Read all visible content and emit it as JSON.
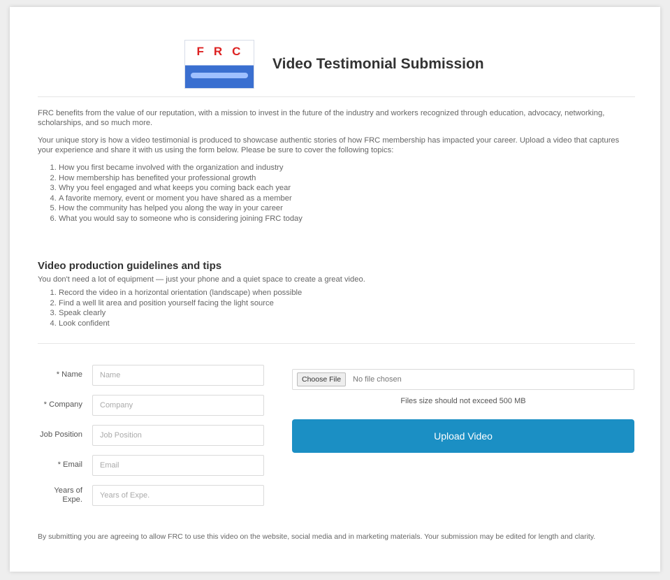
{
  "header": {
    "logo_text": "FRC",
    "title": "Video Testimonial Submission"
  },
  "intro": {
    "paragraph1": "FRC benefits from the value of our reputation, with a mission to invest in the future of the industry and workers recognized through education, advocacy, networking, scholarships, and so much more.",
    "paragraph2": "Your unique story is how a video testimonial is produced to showcase authentic stories of how FRC membership has impacted your career. Upload a video that captures your experience and share it with us using the form below. Please be sure to cover the following topics:",
    "list": [
      "How you first became involved with the organization and industry",
      "How membership has benefited your professional growth",
      "Why you feel engaged and what keeps you coming back each year",
      "A favorite memory, event or moment you have shared as a member",
      "How the community has helped you along the way in your career",
      "What you would say to someone who is considering joining FRC today"
    ]
  },
  "tips": {
    "heading": "Video production guidelines and tips",
    "subtext": "You don't need a lot of equipment — just your phone and a quiet space to create a great video.",
    "list": [
      "Record the video in a horizontal orientation (landscape) when possible",
      "Find a well lit area and position yourself facing the light source",
      "Speak clearly",
      "Look confident"
    ]
  },
  "form": {
    "fields": [
      {
        "label": "* Name",
        "placeholder": "Name"
      },
      {
        "label": "* Company",
        "placeholder": "Company"
      },
      {
        "label": "Job Position",
        "placeholder": "Job Position"
      },
      {
        "label": "* Email",
        "placeholder": "Email"
      },
      {
        "label": "Years of Expe.",
        "placeholder": "Years of Expe."
      }
    ]
  },
  "upload": {
    "choose_label": "Choose File",
    "no_file_text": "No file chosen",
    "max_size_text": "Files size should not exceed 500 MB",
    "submit_label": "Upload Video"
  },
  "footer": {
    "text": "By submitting you are agreeing to allow FRC to use this video on the website, social media and in marketing materials. Your submission may be edited for length and clarity."
  }
}
